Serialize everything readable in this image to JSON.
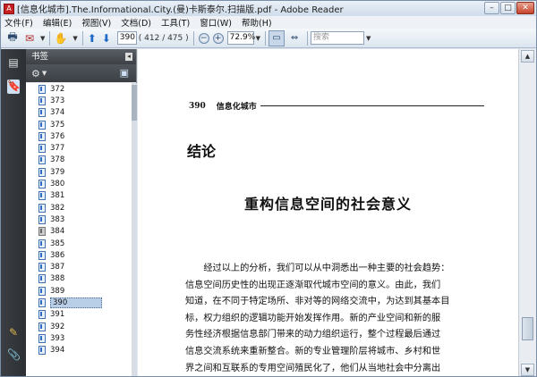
{
  "window": {
    "title": "[信息化城市].The.Informational.City.(曼)卡斯泰尔.扫描版.pdf - Adobe Reader",
    "controls": {
      "minimize": "–",
      "maximize": "□",
      "close": "✕"
    }
  },
  "menu": [
    "文件(F)",
    "编辑(E)",
    "视图(V)",
    "文档(D)",
    "工具(T)",
    "窗口(W)",
    "帮助(H)"
  ],
  "toolbar": {
    "page_number": "390",
    "page_total": "( 412 / 475 )",
    "zoom": "72.9%",
    "search_placeholder": "搜索"
  },
  "panel": {
    "title": "书签",
    "bookmarks": [
      "372",
      "373",
      "374",
      "375",
      "376",
      "377",
      "378",
      "379",
      "380",
      "381",
      "382",
      "383",
      "384",
      "385",
      "386",
      "387",
      "388",
      "389",
      "390",
      "391",
      "392",
      "393",
      "394"
    ],
    "selected": "390"
  },
  "document": {
    "header_page": "390",
    "header_title": "信息化城市",
    "chapter": "结论",
    "title": "重构信息空间的社会意义",
    "paragraph_lines": [
      "　　经过以上的分析，我们可以从中洞悉出一种主要的社会趋势：",
      "信息空间历史性的出现正逐渐取代城市空间的意义。由此，我们",
      "知道，在不同于特定场所、非对等的网络交流中，为达到其基本目",
      "标，权力组织的逻辑功能开始发挥作用。新的产业空间和新的服",
      "务性经济根据信息部门带来的动力组织运行，整个过程最后通过",
      "信息交流系统来重新整合。新的专业管理阶层将城市、乡村和世",
      "界之间和互联系的专用空间殖民化了，他们从当地社会中分离出"
    ]
  },
  "colors": {
    "accent": "#1e6bc7",
    "sidebar_dark": "#3b3f44",
    "selection": "#b9cfe8"
  }
}
